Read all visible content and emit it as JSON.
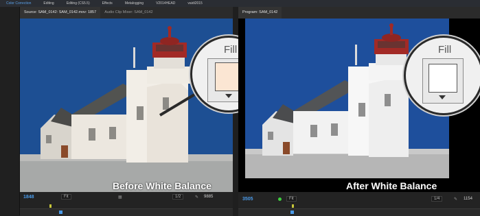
{
  "menu": [
    {
      "label": "Color Correction",
      "active": true
    },
    {
      "label": "Editing",
      "active": false
    },
    {
      "label": "Editing (CS5.5)",
      "active": false
    },
    {
      "label": "Effects",
      "active": false
    },
    {
      "label": "Metalogging",
      "active": false
    },
    {
      "label": "V2014HEAD",
      "active": false
    },
    {
      "label": "vaidi2015",
      "active": false
    }
  ],
  "source_panel": {
    "tab_source": "Source: SAM_0142: SAM_0142.mov: 1857",
    "tab_mixer": "Audio Clip Mixer: SAM_0142",
    "timecode": "1848",
    "fit": "Fit",
    "resolution": "1/2",
    "duration": "9885",
    "caption": "Before White Balance",
    "fill_label": "Fill",
    "fill_color": "#fbe6d3"
  },
  "program_panel": {
    "tab": "Program: SAM_0142",
    "timecode": "3505",
    "fit": "Fit",
    "resolution": "1/4",
    "duration": "1154",
    "caption": "After White Balance",
    "fill_label": "Fill",
    "fill_color": "#ffffff"
  },
  "colors": {
    "accent": "#4a9ae8",
    "sky_before": "#1d4f93",
    "sky_after": "#1e4f9c"
  }
}
